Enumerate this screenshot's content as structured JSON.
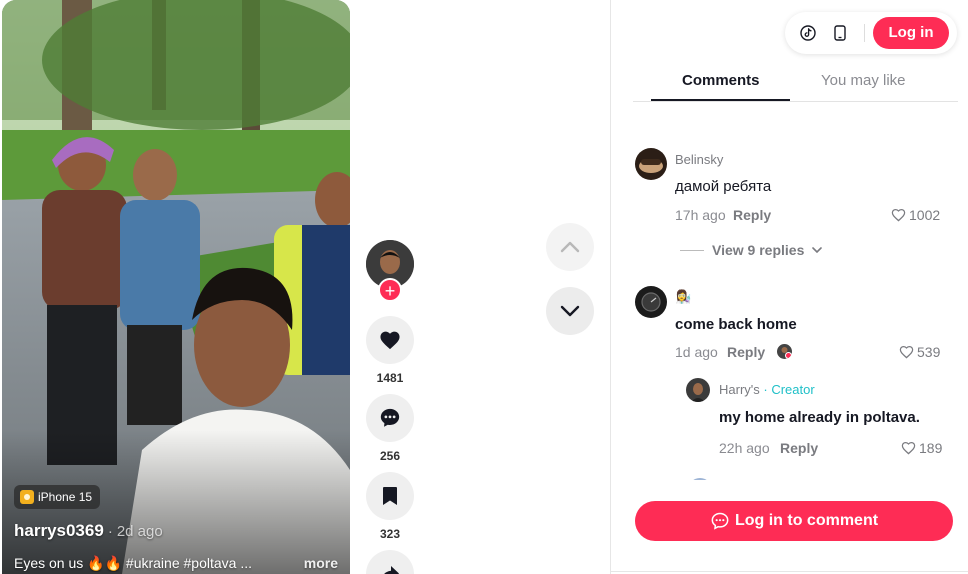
{
  "video": {
    "device_badge": "iPhone 15",
    "author": "harrys0369",
    "separator": "·",
    "age": "2d ago",
    "caption": "Eyes on us 🔥🔥 #ukraine #poltava ...",
    "more": "more"
  },
  "actions": {
    "follow": "+",
    "likes": "1481",
    "comments": "256",
    "saves": "323"
  },
  "header": {
    "login": "Log in",
    "icons": [
      "tiktok-icon",
      "mobile-icon"
    ]
  },
  "tabs": [
    "Comments",
    "You may like"
  ],
  "comments": [
    {
      "user": "Belinsky",
      "text": "дамой ребята",
      "time": "17h ago",
      "reply": "Reply",
      "likes": "1002",
      "view_replies": "View 9 replies"
    },
    {
      "user_emoji": "👩‍🔬",
      "text": "come back home",
      "time": "1d ago",
      "reply": "Reply",
      "likes": "539"
    },
    {
      "user": "Harry's",
      "tag_separator": " · ",
      "tag": "Creator",
      "text": "my home already in poltava.",
      "time": "22h ago",
      "reply": "Reply",
      "likes": "189"
    }
  ],
  "bottom": {
    "login_to_comment": "Log in to comment"
  },
  "colors": {
    "accent": "#fe2c55",
    "creator": "#20c0c8",
    "text": "#161823",
    "muted": "#8a8b91"
  }
}
